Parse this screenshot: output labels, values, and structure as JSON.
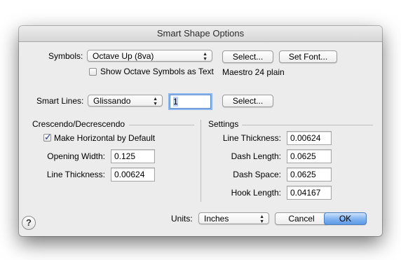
{
  "dialog": {
    "title": "Smart Shape Options"
  },
  "symbols": {
    "label": "Symbols:",
    "selected": "Octave Up (8va)",
    "select_button": "Select...",
    "set_font_button": "Set Font...",
    "show_as_text_label": "Show Octave Symbols as Text",
    "show_as_text_checked": false,
    "font_info": "Maestro 24 plain"
  },
  "smart_lines": {
    "label": "Smart Lines:",
    "selected": "Glissando",
    "number_value": "1",
    "select_button": "Select..."
  },
  "crescendo": {
    "title": "Crescendo/Decrescendo",
    "make_horizontal_label": "Make Horizontal by Default",
    "make_horizontal_checked": true,
    "opening_width_label": "Opening Width:",
    "opening_width_value": "0.125",
    "line_thickness_label": "Line Thickness:",
    "line_thickness_value": "0.00624"
  },
  "settings": {
    "title": "Settings",
    "line_thickness_label": "Line Thickness:",
    "line_thickness_value": "0.00624",
    "dash_length_label": "Dash Length:",
    "dash_length_value": "0.0625",
    "dash_space_label": "Dash Space:",
    "dash_space_value": "0.0625",
    "hook_length_label": "Hook Length:",
    "hook_length_value": "0.04167"
  },
  "footer": {
    "units_label": "Units:",
    "units_selected": "Inches",
    "cancel_button": "Cancel",
    "ok_button": "OK",
    "help_glyph": "?"
  }
}
